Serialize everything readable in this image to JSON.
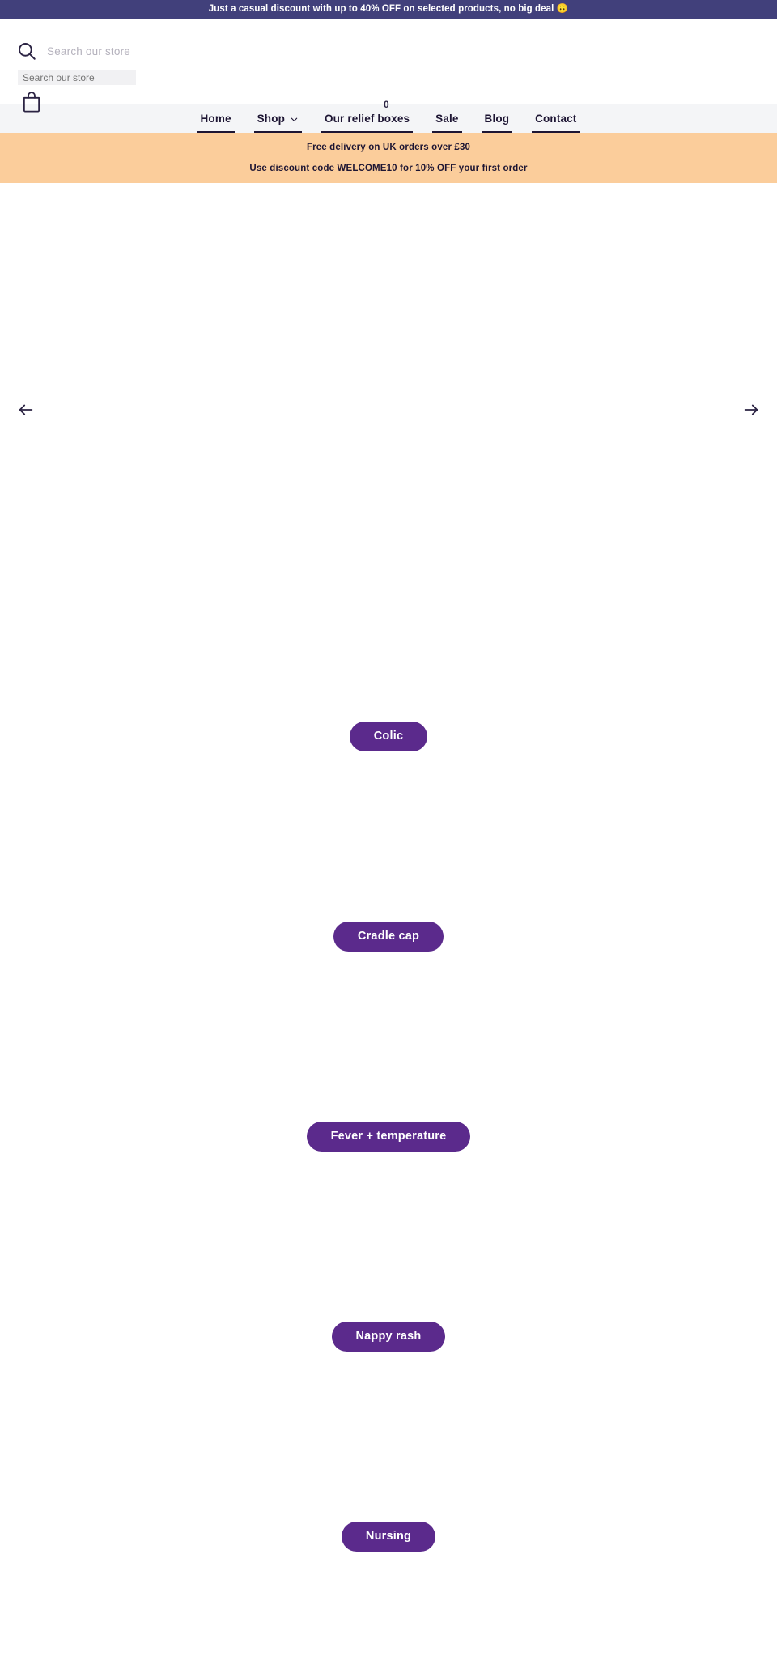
{
  "announcement": {
    "text": "Just a casual discount with up to 40% OFF on selected products, no big deal 🙃"
  },
  "header": {
    "search_placeholder": "Search our store",
    "search_value": "",
    "search_icon": "search-icon",
    "cart_icon": "shopping-bag-icon",
    "cart_count": "0"
  },
  "nav": {
    "items": [
      {
        "label": "Home",
        "has_dropdown": false
      },
      {
        "label": "Shop",
        "has_dropdown": true
      },
      {
        "label": "Our relief boxes",
        "has_dropdown": false
      },
      {
        "label": "Sale",
        "has_dropdown": false
      },
      {
        "label": "Blog",
        "has_dropdown": false
      },
      {
        "label": "Contact",
        "has_dropdown": false
      }
    ]
  },
  "promo": {
    "line1": "Free delivery on UK orders over £30",
    "line2": "Use discount code WELCOME10 for 10% OFF your first order"
  },
  "carousel": {
    "prev_label": "Previous slide",
    "next_label": "Next slide"
  },
  "categories": [
    {
      "label": "Colic"
    },
    {
      "label": "Cradle cap"
    },
    {
      "label": "Fever + temperature"
    },
    {
      "label": "Nappy rash"
    },
    {
      "label": "Nursing"
    }
  ],
  "colors": {
    "announcement_bg": "#41407b",
    "nav_bg": "#f4f5f7",
    "promo_bg": "#fbcd9b",
    "pill_bg": "#5b2a8c",
    "ink": "#1d1533"
  }
}
